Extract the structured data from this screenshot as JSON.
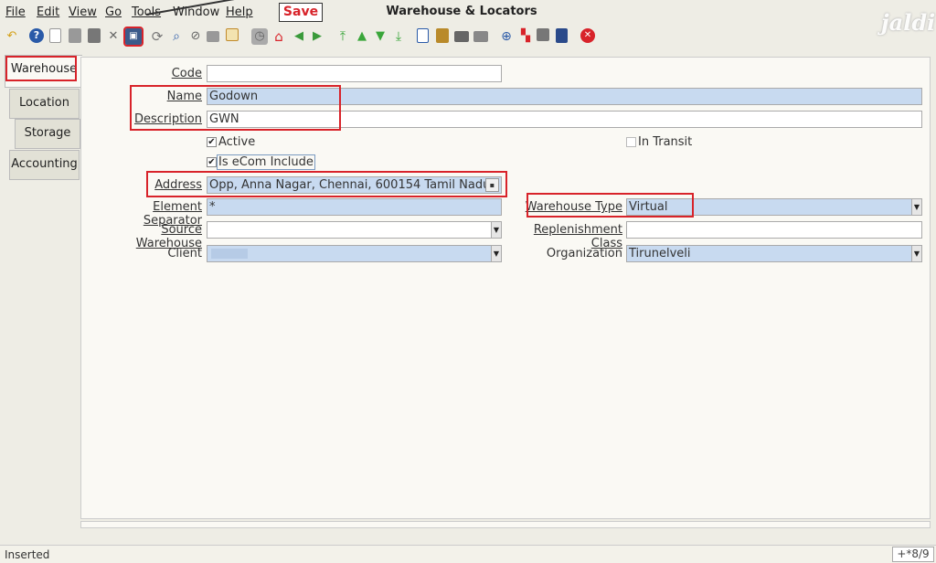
{
  "menu": {
    "file": "File",
    "edit": "Edit",
    "view": "View",
    "go": "Go",
    "tools": "Tools",
    "window": "Window",
    "help": "Help"
  },
  "window_title": "Warehouse & Locators",
  "logo": "jaldi",
  "annotation": {
    "save": "Save"
  },
  "toolbar": {
    "icons": [
      "undo-icon",
      "help-icon",
      "new-icon",
      "copy-icon",
      "delete-icon",
      "delete-selection-icon",
      "save-icon",
      "refresh-icon",
      "find-icon",
      "attachment-icon",
      "chat-icon",
      "grid-toggle-icon",
      "history-icon",
      "home-icon",
      "previous-icon",
      "next-icon",
      "first-record-icon",
      "previous-record-icon",
      "next-record-icon",
      "last-record-icon",
      "report-icon",
      "archive-icon",
      "print-icon",
      "print-preview-icon",
      "zoom-across-icon",
      "workflow-icon",
      "product-info-icon",
      "request-icon",
      "exit-icon"
    ]
  },
  "tabs": [
    "Warehouse",
    "Location",
    "Storage",
    "Accounting"
  ],
  "form": {
    "code": {
      "label": "Code",
      "value": ""
    },
    "name": {
      "label": "Name",
      "value": "Godown"
    },
    "description": {
      "label": "Description",
      "value": "GWN"
    },
    "active": {
      "label": "Active",
      "checked": true
    },
    "in_transit": {
      "label": "In Transit",
      "checked": false
    },
    "is_ecom": {
      "label": "Is eCom Include",
      "checked": true
    },
    "address": {
      "label": "Address",
      "value": "Opp, Anna Nagar, Chennai,  600154 Tamil Nadu"
    },
    "element_separator": {
      "label": "Element Separator",
      "value": "*"
    },
    "warehouse_type": {
      "label": "Warehouse Type",
      "value": "Virtual"
    },
    "source_warehouse": {
      "label": "Source Warehouse",
      "value": ""
    },
    "replenishment_class": {
      "label": "Replenishment Class",
      "value": ""
    },
    "client": {
      "label": "Client",
      "value": ""
    },
    "organization": {
      "label": "Organization",
      "value": "Tirunelveli"
    }
  },
  "status": {
    "text": "Inserted",
    "record": "+*8/9"
  },
  "colors": {
    "mandatory": "#c8daf0",
    "annotation_red": "#d8232a",
    "panel": "#faf9f4"
  }
}
